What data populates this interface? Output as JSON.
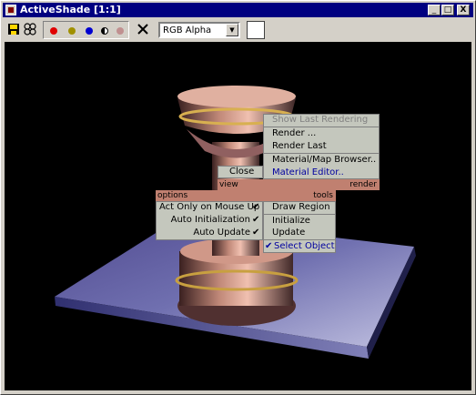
{
  "window": {
    "title": "ActiveShade [1:1]",
    "caption_buttons": [
      "_",
      "□",
      "X"
    ]
  },
  "toolbar": {
    "channel_select": {
      "value": "RGB Alpha"
    },
    "icons": [
      "save-icon",
      "copy-icon",
      "red-channel-icon",
      "green-channel-icon",
      "blue-channel-icon",
      "monochrome-icon",
      "alpha-channel-icon",
      "clear-icon"
    ]
  },
  "quad_menu": {
    "render": {
      "header": "render",
      "items": [
        "Show Last Rendering",
        "Render ...",
        "Render Last",
        "Material/Map Browser..",
        "Material Editor.."
      ]
    },
    "view": {
      "header": "view",
      "items": [
        "Close"
      ]
    },
    "options": {
      "header": "options",
      "items": [
        "Act Only on Mouse Up",
        "Auto Initialization",
        "Auto Update"
      ]
    },
    "tools": {
      "header": "tools",
      "items": [
        "Draw Region",
        "Initialize",
        "Update",
        "Select Object"
      ]
    }
  },
  "colors": {
    "title_bar": "#000080",
    "viewport_bg": "#000000",
    "menu_bg": "#c4c7bd",
    "menu_header": "#c08070",
    "highlight_text": "#0000a0"
  }
}
